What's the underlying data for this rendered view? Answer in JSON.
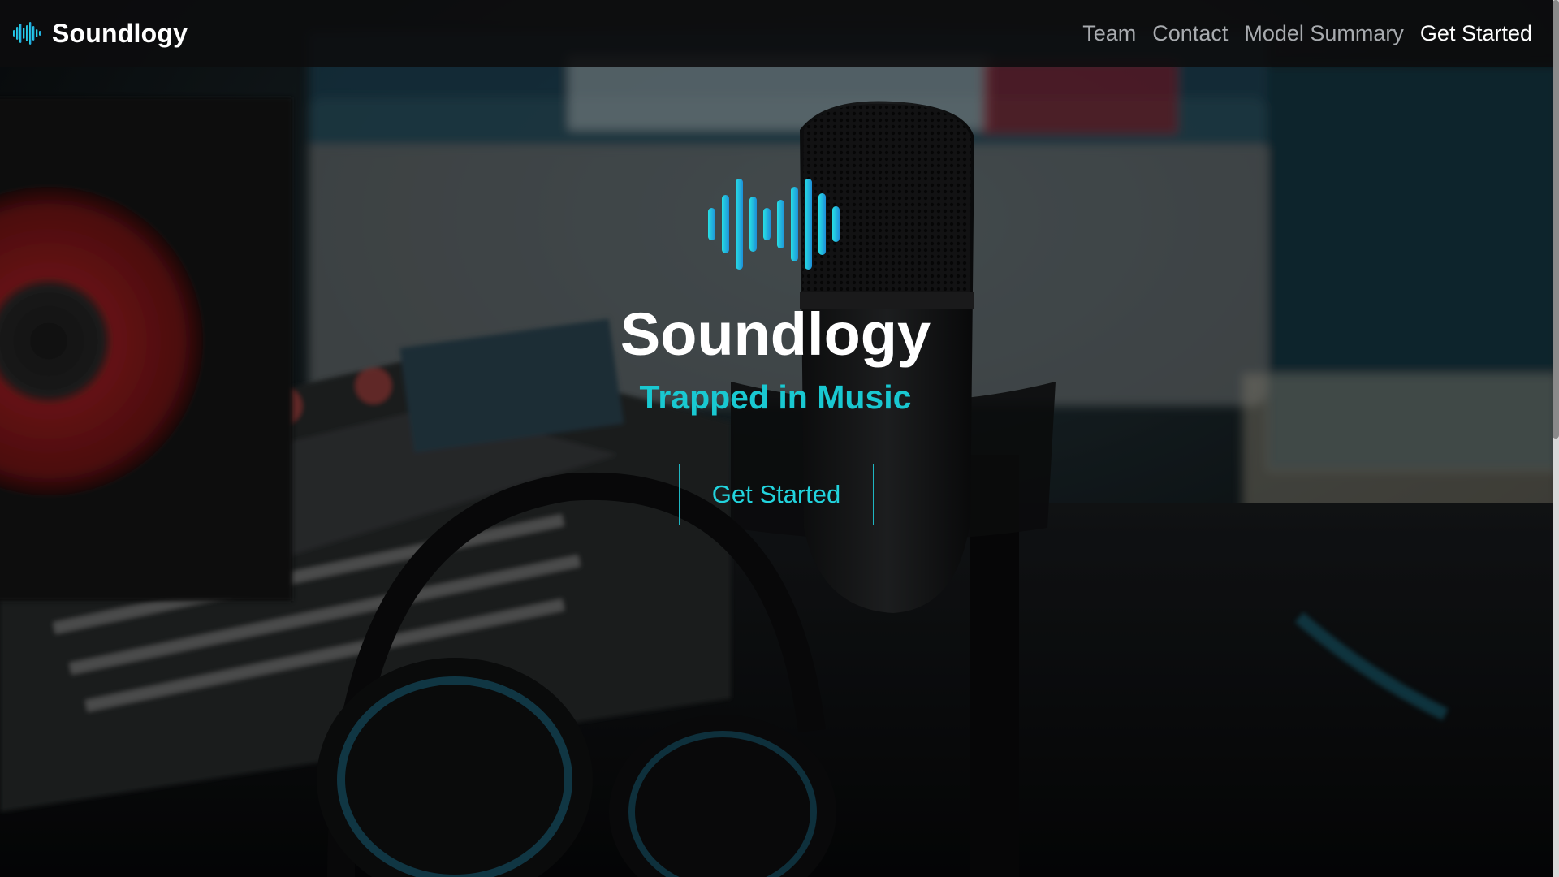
{
  "colors": {
    "accent": "#19c8d1",
    "accent_gradient_start": "#27e0e4",
    "accent_gradient_end": "#1e8fd8",
    "nav_background": "#0c0c0e",
    "nav_link": "#a8abaf",
    "nav_link_active": "#ffffff"
  },
  "navbar": {
    "brand": {
      "logo_icon": "sound-wave-icon",
      "name": "Soundlogy"
    },
    "links": [
      {
        "label": "Team"
      },
      {
        "label": "Contact"
      },
      {
        "label": "Model Summary"
      },
      {
        "label": "Get Started",
        "active": true
      }
    ]
  },
  "hero": {
    "background": "recording-studio-photo",
    "logo_icon": "sound-wave-icon",
    "title": "Soundlogy",
    "tagline": "Trapped in Music",
    "cta_label": "Get Started"
  }
}
